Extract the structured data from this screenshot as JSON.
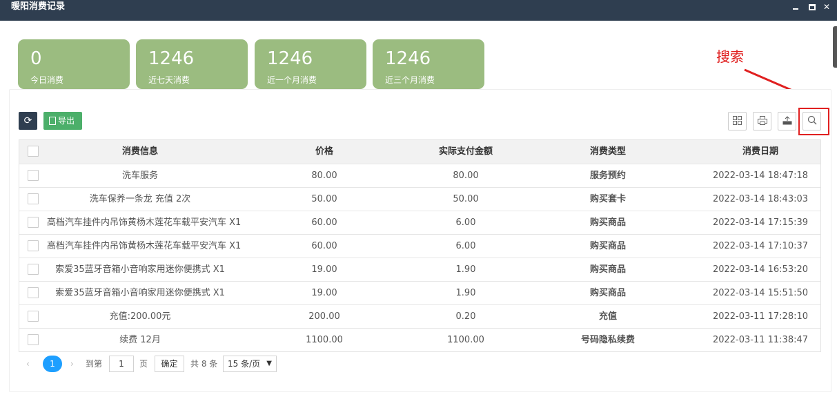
{
  "window": {
    "title": "暖阳消费记录"
  },
  "stats": [
    {
      "value": "0",
      "label": "今日消费"
    },
    {
      "value": "1246",
      "label": "近七天消费"
    },
    {
      "value": "1246",
      "label": "近一个月消费"
    },
    {
      "value": "1246",
      "label": "近三个月消费"
    }
  ],
  "toolbar": {
    "refresh_icon": "refresh-icon",
    "export_label": "导出",
    "right_icons": [
      "columns-icon",
      "print-icon",
      "export-icon",
      "search-icon"
    ]
  },
  "annotation": {
    "text": "搜索",
    "color": "#e02020"
  },
  "table": {
    "headers": {
      "info": "消费信息",
      "price": "价格",
      "paid": "实际支付金额",
      "type": "消费类型",
      "date": "消费日期"
    },
    "rows": [
      {
        "info": "洗车服务",
        "price": "80.00",
        "paid": "80.00",
        "type": "服务预约",
        "date": "2022-03-14 18:47:18"
      },
      {
        "info": "洗车保养一条龙 充值 2次",
        "price": "50.00",
        "paid": "50.00",
        "type": "购买套卡",
        "date": "2022-03-14 18:43:03"
      },
      {
        "info": "高档汽车挂件内吊饰黄杨木莲花车载平安汽车 X1",
        "price": "60.00",
        "paid": "6.00",
        "type": "购买商品",
        "date": "2022-03-14 17:15:39"
      },
      {
        "info": "高档汽车挂件内吊饰黄杨木莲花车载平安汽车 X1",
        "price": "60.00",
        "paid": "6.00",
        "type": "购买商品",
        "date": "2022-03-14 17:10:37"
      },
      {
        "info": "索爱35蓝牙音箱小音响家用迷你便携式 X1",
        "price": "19.00",
        "paid": "1.90",
        "type": "购买商品",
        "date": "2022-03-14 16:53:20"
      },
      {
        "info": "索爱35蓝牙音箱小音响家用迷你便携式 X1",
        "price": "19.00",
        "paid": "1.90",
        "type": "购买商品",
        "date": "2022-03-14 15:51:50"
      },
      {
        "info": "充值:200.00元",
        "price": "200.00",
        "paid": "0.20",
        "type": "充值",
        "date": "2022-03-11 17:28:10"
      },
      {
        "info": "续费 12月",
        "price": "1100.00",
        "paid": "1100.00",
        "type": "号码隐私续费",
        "date": "2022-03-11 11:38:47"
      }
    ]
  },
  "pager": {
    "current": "1",
    "goto_label": "到第",
    "page_value": "1",
    "page_label": "页",
    "confirm_label": "确定",
    "total": "共 8 条",
    "page_size": "15 条/页"
  },
  "colors": {
    "titlebar": "#2f3e50",
    "stat_card": "#9bbc80",
    "export_green": "#4caf6a",
    "pager_active": "#1e9fff",
    "highlight": "#e02020"
  }
}
